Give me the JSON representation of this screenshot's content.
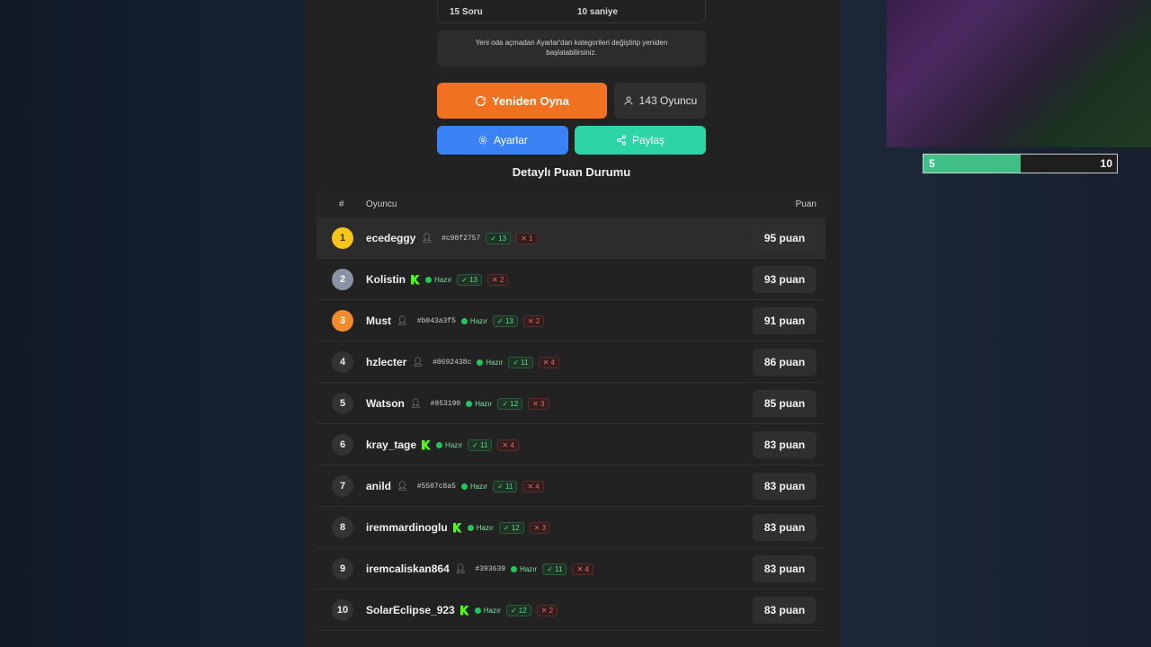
{
  "settings_summary": {
    "questions": "15 Soru",
    "time": "10 saniye"
  },
  "note": "Yeni oda açmadan Ayarlar'dan kategorileri değiştirip yeniden başlatabilirsiniz.",
  "buttons": {
    "replay": "Yeniden Oyna",
    "players": "143 Oyuncu",
    "settings": "Ayarlar",
    "share": "Paylaş"
  },
  "section_title": "Detaylı Puan Durumu",
  "table": {
    "headers": {
      "rank": "#",
      "player": "Oyuncu",
      "score": "Puan"
    },
    "rows": [
      {
        "rank": "1",
        "name": "ecedeggy",
        "hash": "#c98f2757",
        "ready": "",
        "correct": "13",
        "wrong": "1",
        "score": "95 puan"
      },
      {
        "rank": "2",
        "name": "Kolistin",
        "hash": "",
        "ready": "Hazır",
        "correct": "13",
        "wrong": "2",
        "score": "93 puan"
      },
      {
        "rank": "3",
        "name": "Must",
        "hash": "#b043a3f5",
        "ready": "Hazır",
        "correct": "13",
        "wrong": "2",
        "score": "91 puan"
      },
      {
        "rank": "4",
        "name": "hzlecter",
        "hash": "#8692438c",
        "ready": "Hazır",
        "correct": "11",
        "wrong": "4",
        "score": "86 puan"
      },
      {
        "rank": "5",
        "name": "Watson",
        "hash": "#953190",
        "ready": "Hazır",
        "correct": "12",
        "wrong": "3",
        "score": "85 puan"
      },
      {
        "rank": "6",
        "name": "kray_tage",
        "hash": "",
        "ready": "Hazır",
        "correct": "11",
        "wrong": "4",
        "score": "83 puan"
      },
      {
        "rank": "7",
        "name": "anild",
        "hash": "#5507c8a5",
        "ready": "Hazır",
        "correct": "11",
        "wrong": "4",
        "score": "83 puan"
      },
      {
        "rank": "8",
        "name": "iremmardinoglu",
        "hash": "",
        "ready": "Hazır",
        "correct": "12",
        "wrong": "3",
        "score": "83 puan"
      },
      {
        "rank": "9",
        "name": "iremcaliskan864",
        "hash": "#393639",
        "ready": "Hazır",
        "correct": "11",
        "wrong": "4",
        "score": "83 puan"
      },
      {
        "rank": "10",
        "name": "SolarEclipse_923",
        "hash": "",
        "ready": "Hazır",
        "correct": "12",
        "wrong": "2",
        "score": "83 puan"
      }
    ]
  },
  "overlay": {
    "progress_left": "5",
    "progress_right": "10",
    "progress_fraction": 0.5
  },
  "colors": {
    "accent_orange": "#f0711f",
    "accent_blue": "#3b82f6",
    "accent_teal": "#2dd4a6",
    "kick_green": "#53fc18"
  }
}
